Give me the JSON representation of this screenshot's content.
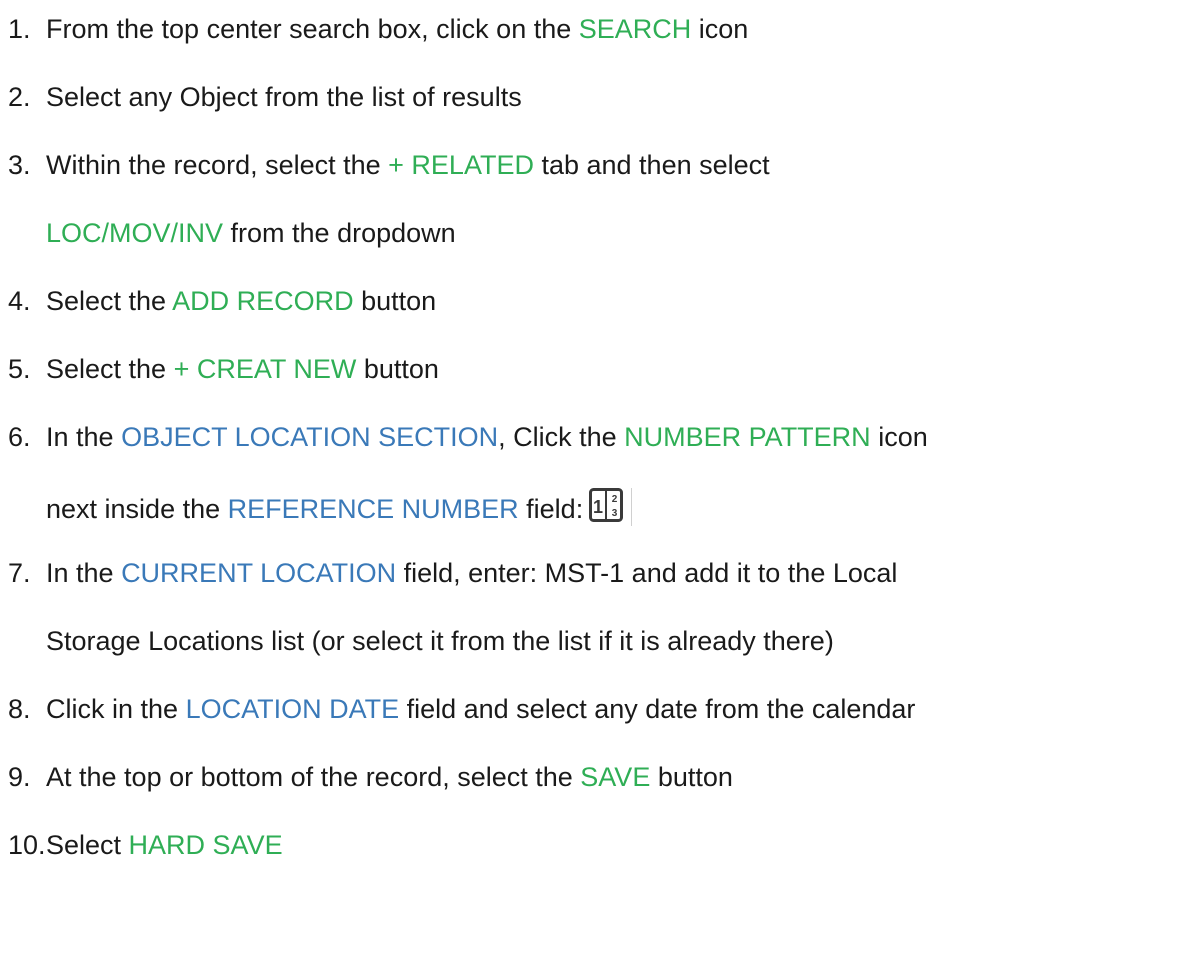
{
  "steps": [
    {
      "num": "1.",
      "parts": [
        {
          "t": "From the top center search box, click on the ",
          "c": ""
        },
        {
          "t": "SEARCH",
          "c": "green"
        },
        {
          "t": " icon",
          "c": ""
        }
      ]
    },
    {
      "num": "2.",
      "parts": [
        {
          "t": "Select any Object from the list of results",
          "c": ""
        }
      ]
    },
    {
      "num": "3.",
      "parts": [
        {
          "t": "Within the record, select the ",
          "c": ""
        },
        {
          "t": "+ RELATED",
          "c": "green"
        },
        {
          "t": " tab and then select",
          "c": ""
        }
      ],
      "cont": [
        {
          "t": "LOC/MOV/INV",
          "c": "green"
        },
        {
          "t": " from the dropdown",
          "c": ""
        }
      ]
    },
    {
      "num": "4.",
      "parts": [
        {
          "t": "Select the ",
          "c": ""
        },
        {
          "t": "ADD RECORD",
          "c": "green"
        },
        {
          "t": " button",
          "c": ""
        }
      ]
    },
    {
      "num": "5.",
      "parts": [
        {
          "t": "Select the ",
          "c": ""
        },
        {
          "t": "+ CREAT NEW",
          "c": "green"
        },
        {
          "t": " button",
          "c": ""
        }
      ]
    },
    {
      "num": "6.",
      "parts": [
        {
          "t": "In the ",
          "c": ""
        },
        {
          "t": "OBJECT LOCATION SECTION",
          "c": "blue"
        },
        {
          "t": ", Click the ",
          "c": ""
        },
        {
          "t": "NUMBER PATTERN",
          "c": "green"
        },
        {
          "t": " icon",
          "c": ""
        }
      ],
      "cont": [
        {
          "t": "next inside the ",
          "c": ""
        },
        {
          "t": "REFERENCE NUMBER",
          "c": "blue"
        },
        {
          "t": " field:",
          "c": ""
        }
      ],
      "icon": "number-pattern-icon"
    },
    {
      "num": "7.",
      "parts": [
        {
          "t": "In the ",
          "c": ""
        },
        {
          "t": "CURRENT LOCATION",
          "c": "blue"
        },
        {
          "t": " field, enter: MST-1 and add it to the Local",
          "c": ""
        }
      ],
      "cont": [
        {
          "t": "Storage Locations list (or select it from the list if it is already there)",
          "c": ""
        }
      ]
    },
    {
      "num": "8.",
      "parts": [
        {
          "t": "Click in the ",
          "c": ""
        },
        {
          "t": "LOCATION DATE",
          "c": "blue"
        },
        {
          "t": " field and select any date from the calendar",
          "c": ""
        }
      ]
    },
    {
      "num": "9.",
      "parts": [
        {
          "t": "At the top or bottom of the record, select the ",
          "c": ""
        },
        {
          "t": "SAVE",
          "c": "green"
        },
        {
          "t": " button",
          "c": ""
        }
      ]
    },
    {
      "num": "10.",
      "parts": [
        {
          "t": "Select ",
          "c": ""
        },
        {
          "t": "HARD SAVE",
          "c": "green"
        }
      ]
    }
  ],
  "colors": {
    "green": "#2fae55",
    "blue": "#3a79b8",
    "text": "#1a1a1a"
  }
}
